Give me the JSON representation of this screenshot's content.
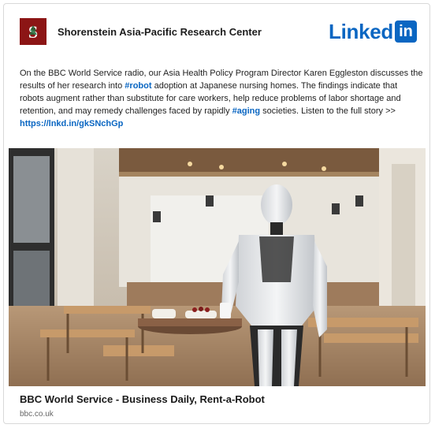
{
  "post": {
    "org_name": "Shorenstein Asia-Pacific Research Center",
    "org_logo_icon": "stanford-s-tree-logo",
    "platform_logo": {
      "word": "Linked",
      "box": "in",
      "color": "#0a66c2"
    },
    "text": {
      "p1": "On the BBC World Service radio, our Asia Health Policy Program Director Karen Eggleston discusses the results of her research into ",
      "hashtag1": "#robot",
      "p2": " adoption at Japanese nursing homes. The findings indicate that robots augment rather than substitute for care workers, help reduce problems of labor shortage and retention, and may remedy challenges faced by rapidly ",
      "hashtag2": "#aging",
      "p3": " societies. Listen to the full story >> ",
      "link": "https://lnkd.in/gkSNchGp"
    },
    "image_icon": "humanoid-robot-waiter-in-restaurant-photo",
    "link_preview": {
      "title": "BBC World Service - Business Daily, Rent-a-Robot",
      "domain": "bbc.co.uk"
    }
  },
  "colors": {
    "accent": "#0a66c2",
    "logo_red": "#8c1515"
  }
}
